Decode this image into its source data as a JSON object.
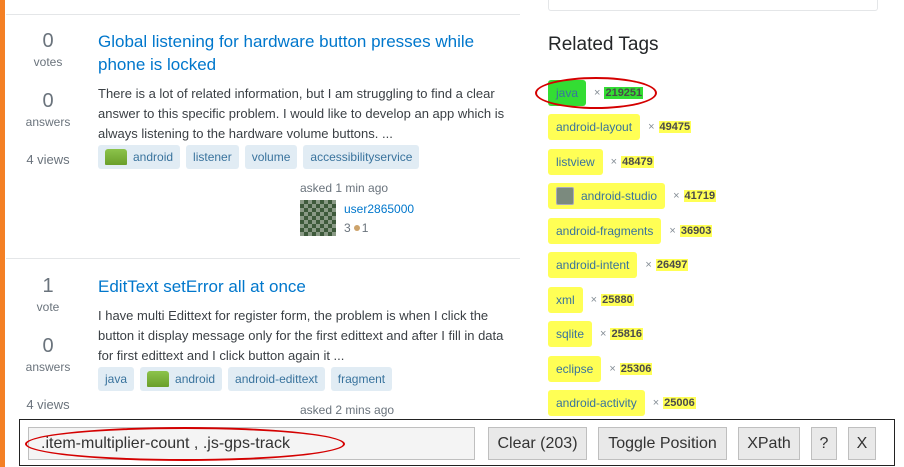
{
  "questions": [
    {
      "votes": "0",
      "votes_label": "votes",
      "answers": "0",
      "answers_label": "answers",
      "views": "4 views",
      "title_line1": "Global listening for hardware button presses while",
      "title_line2": "phone is locked",
      "excerpt": "There is a lot of related information, but I am struggling to find a clear answer to this specific problem. I would like to develop an app which is always listening to the hardware volume buttons. ...",
      "tags": [
        "android",
        "listener",
        "volume",
        "accessibilityservice"
      ],
      "asked": "asked 1 min ago",
      "user": "user2865000",
      "rep": "3",
      "bronze": "1"
    },
    {
      "votes": "1",
      "votes_label": "vote",
      "answers": "0",
      "answers_label": "answers",
      "views": "4 views",
      "title_line1": "EditText setError all at once",
      "excerpt": "I have multi Edittext for register form, the problem is when I click the button it display message only for the first edittext and after I fill in data for first edittext and I click button again it ...",
      "tags": [
        "java",
        "android",
        "android-edittext",
        "fragment"
      ],
      "asked": "asked 2 mins ago"
    }
  ],
  "related_tags": {
    "title": "Related Tags",
    "multiplier": "×",
    "items": [
      {
        "name": "java",
        "count": "219251"
      },
      {
        "name": "android-layout",
        "count": "49475"
      },
      {
        "name": "listview",
        "count": "48479"
      },
      {
        "name": "android-studio",
        "count": "41719"
      },
      {
        "name": "android-fragments",
        "count": "36903"
      },
      {
        "name": "android-intent",
        "count": "26497"
      },
      {
        "name": "xml",
        "count": "25880"
      },
      {
        "name": "sqlite",
        "count": "25816"
      },
      {
        "name": "eclipse",
        "count": "25306"
      },
      {
        "name": "android-activity",
        "count": "25006"
      }
    ]
  },
  "toolbar": {
    "selector_value": ".item-multiplier-count , .js-gps-track",
    "clear_label": "Clear (203)",
    "toggle_label": "Toggle Position",
    "xpath_label": "XPath",
    "help_label": "?",
    "close_label": "X"
  },
  "colors": {
    "accent": "#f48024",
    "link": "#0077cc",
    "tag_bg": "#e1ecf4",
    "highlight_yellow": "#ffff55",
    "highlight_green": "#33dd33",
    "annotation_red": "#d40000"
  }
}
